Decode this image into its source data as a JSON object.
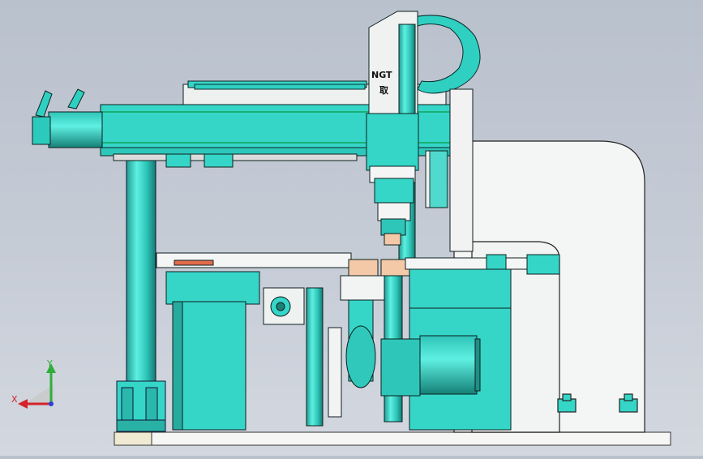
{
  "viewport": {
    "background": "#c4cad4",
    "part_color": "#35d6c8",
    "part_dark": "#1e8f86",
    "edge_color": "#0d1f1e",
    "frame_color": "#f2f3f3",
    "highlight_color": "#f3c9a8"
  },
  "labels": {
    "head_text": "NGT",
    "head_glyph": "取"
  },
  "triad": {
    "x_label": "X",
    "y_label": "Y",
    "x_color": "#d4232a",
    "y_color": "#2fae3a",
    "z_color": "#2a3fd6"
  }
}
